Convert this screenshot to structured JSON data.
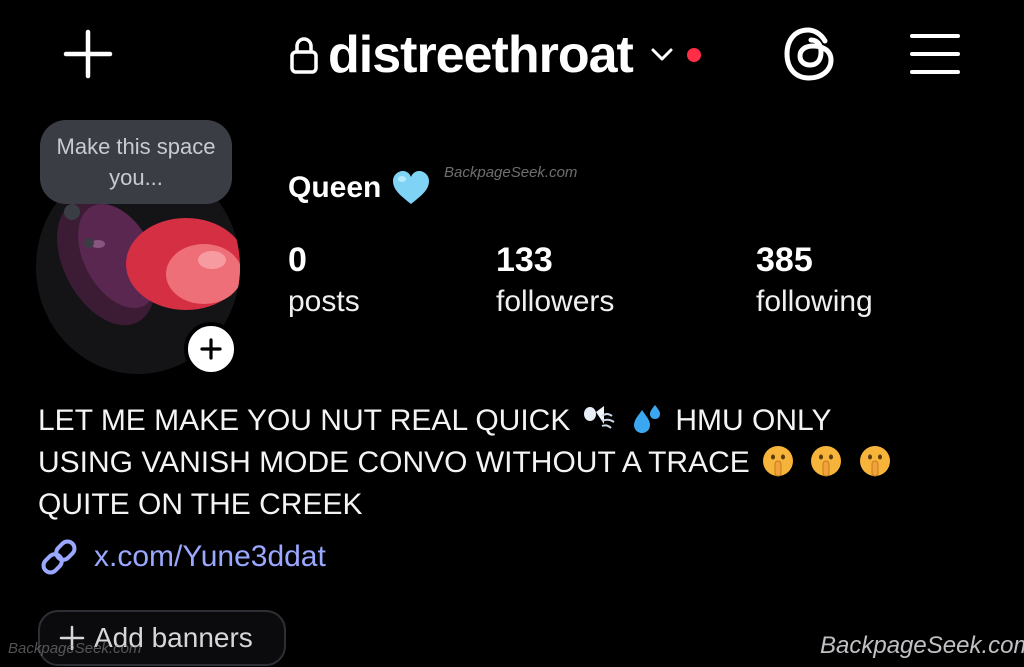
{
  "header": {
    "username": "distreethroat",
    "icons": [
      "plus-icon",
      "lock-icon",
      "chevron-down-icon",
      "notification-dot",
      "threads-icon",
      "menu-icon"
    ],
    "notification_color": "#ff2d46"
  },
  "profile": {
    "note": "Make this space you...",
    "display_name": "Queen",
    "name_emoji": "light-blue-heart",
    "stats": {
      "posts": {
        "value": "0",
        "label": "posts"
      },
      "followers": {
        "value": "133",
        "label": "followers"
      },
      "following": {
        "value": "385",
        "label": "following"
      }
    },
    "bio": {
      "line1_a": "LET ME MAKE YOU NUT REAL QUICK",
      "line1_b": "HMU ONLY",
      "line2": "USING VANISH MODE CONVO WITHOUT A TRACE",
      "line3": "QUITE ON THE CREEK",
      "emojis": [
        "wind-face",
        "sweat-droplets",
        "shushing-face",
        "shushing-face",
        "shushing-face"
      ]
    },
    "link": "x.com/Yune3ddat",
    "link_color": "#9aa8ff",
    "add_banners_label": "Add banners"
  },
  "watermarks": {
    "top": "BackpageSeek.com",
    "bottom_left": "BackpageSeek.com",
    "bottom_right": "BackpageSeek.com"
  }
}
